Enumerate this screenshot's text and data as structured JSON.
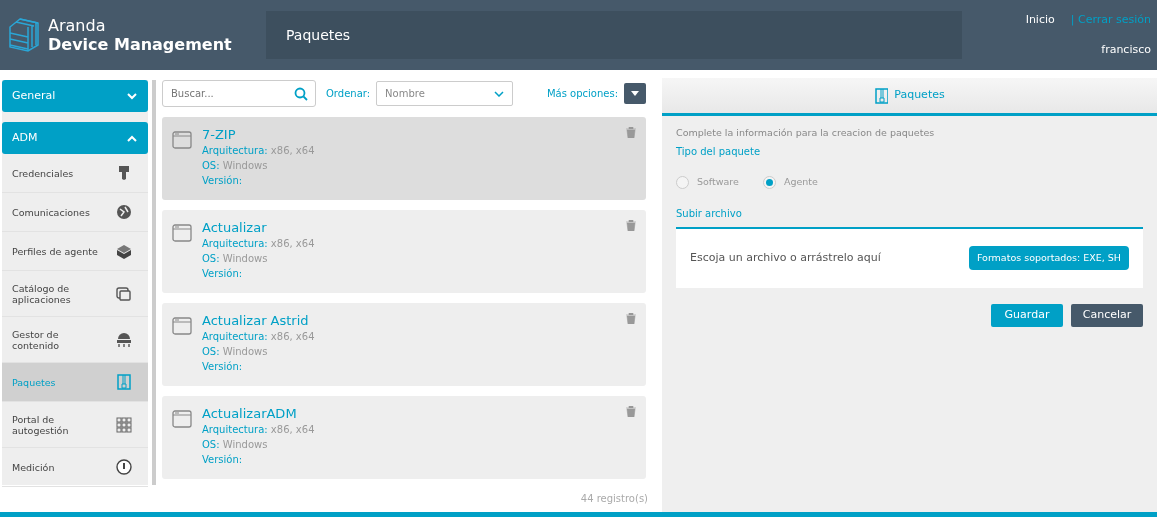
{
  "header": {
    "logo_line1": "Aranda",
    "logo_line2": "Device Management",
    "page_title": "Paquetes",
    "home_link": "Inicio",
    "logout_link": "| Cerrar sesión",
    "user": "francisco"
  },
  "sidebar": {
    "sections": [
      {
        "label": "General",
        "expanded": false
      },
      {
        "label": "ADM",
        "expanded": true,
        "items": [
          {
            "label": "Credenciales",
            "selected": false
          },
          {
            "label": "Comunicaciones",
            "selected": false
          },
          {
            "label": "Perfiles de agente",
            "selected": false
          },
          {
            "label": "Catálogo de aplicaciones",
            "selected": false
          },
          {
            "label": "Gestor de contenido",
            "selected": false
          },
          {
            "label": "Paquetes",
            "selected": true
          },
          {
            "label": "Portal de autogestión",
            "selected": false
          },
          {
            "label": "Medición",
            "selected": false
          }
        ]
      }
    ]
  },
  "toolbar": {
    "search": {
      "placeholder": "Buscar..."
    },
    "sort_label": "Ordenar:",
    "sort_value": "Nombre",
    "more_label": "Más opciones:"
  },
  "packages": [
    {
      "name": "7-ZIP",
      "selected": true,
      "fields": [
        {
          "label": "Arquitectura:",
          "value": "x86, x64"
        },
        {
          "label": "OS:",
          "value": "Windows"
        },
        {
          "label": "Versión:"
        }
      ]
    },
    {
      "name": "Actualizar",
      "selected": false,
      "fields": [
        {
          "label": "Arquitectura:",
          "value": "x86, x64"
        },
        {
          "label": "OS:",
          "value": "Windows"
        },
        {
          "label": "Versión:"
        }
      ]
    },
    {
      "name": "Actualizar Astrid",
      "selected": false,
      "fields": [
        {
          "label": "Arquitectura:",
          "value": "x86, x64"
        },
        {
          "label": "OS:",
          "value": "Windows"
        },
        {
          "label": "Versión:"
        }
      ]
    },
    {
      "name": "ActualizarADM",
      "selected": false,
      "fields": [
        {
          "label": "Arquitectura:",
          "value": "x86, x64"
        },
        {
          "label": "OS:",
          "value": "Windows"
        },
        {
          "label": "Versión:"
        }
      ]
    }
  ],
  "record_count": "44 registro(s)",
  "panel": {
    "tab": "Paquetes",
    "intro": "Complete la información para la creacion de paquetes",
    "type_heading": "Tipo del paquete",
    "options": [
      {
        "label": "Software",
        "selected": false
      },
      {
        "label": "Agente",
        "selected": true
      }
    ],
    "upload_heading": "Subir archivo",
    "dropzone_text": "Escoja un archivo o arrástrelo aquí",
    "formats_badge": "Formatos soportados: EXE, SH",
    "buttons": [
      {
        "label": "Guardar",
        "kind": "primary"
      },
      {
        "label": "Cancelar",
        "kind": "secondary"
      }
    ]
  }
}
